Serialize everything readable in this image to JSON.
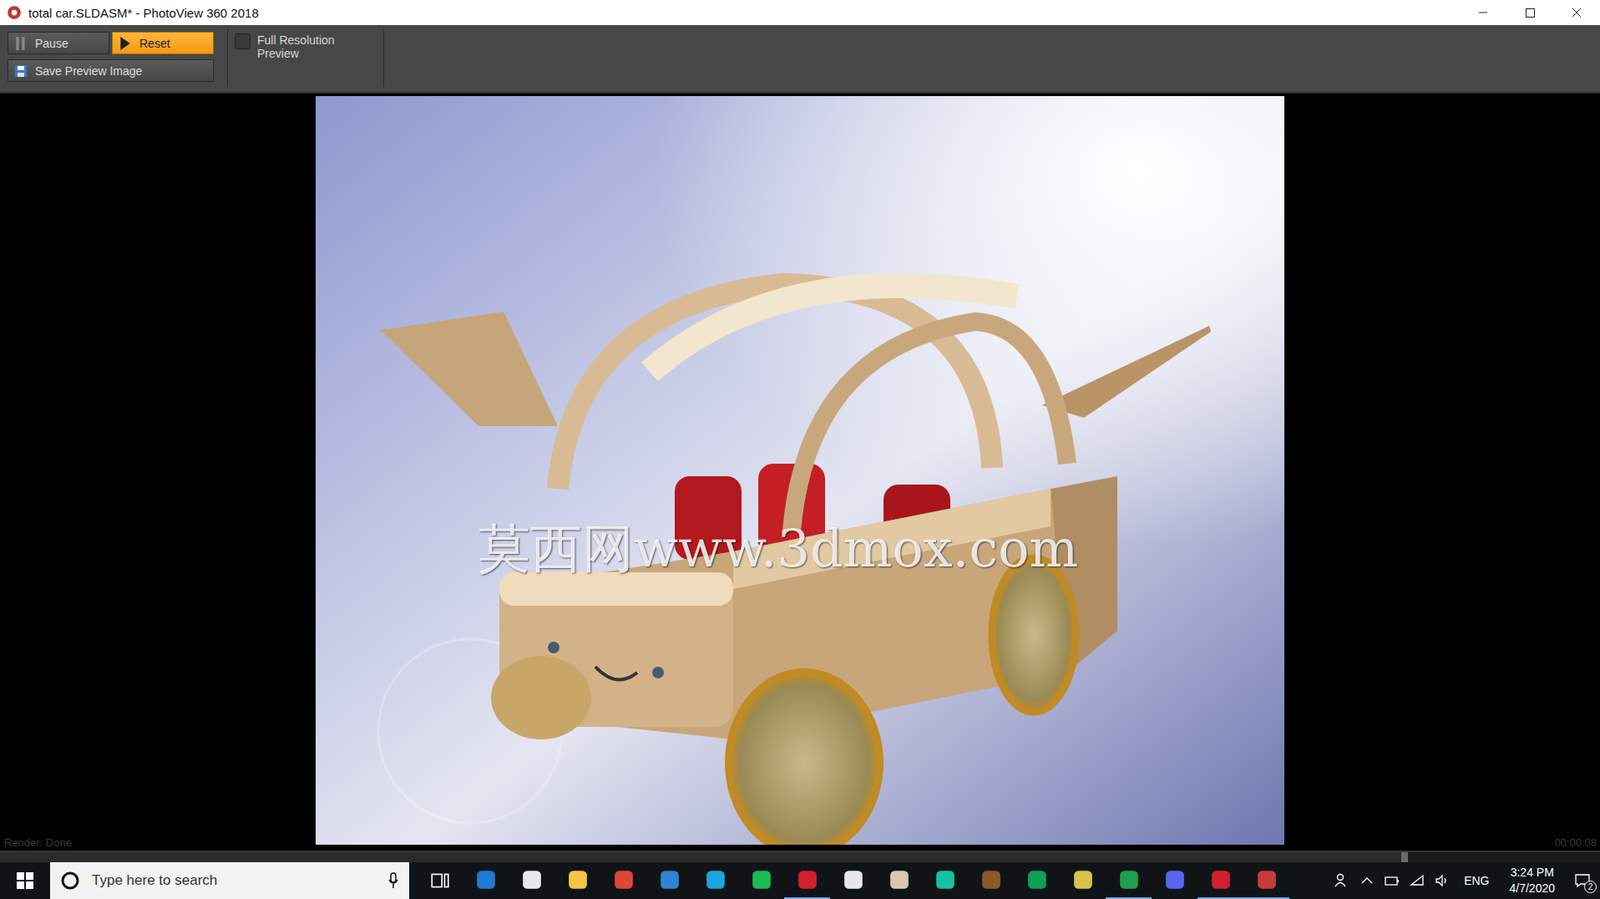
{
  "window": {
    "title": "total car.SLDASM* - PhotoView 360 2018"
  },
  "toolbar": {
    "buttons": [
      {
        "label": "Pause",
        "kind": "pause",
        "selected": false
      },
      {
        "label": "Reset",
        "kind": "play",
        "selected": true
      }
    ],
    "checkbox": {
      "label": "Full Resolution Preview",
      "checked": false
    },
    "save": {
      "label": "Save Preview Image"
    }
  },
  "render": {
    "watermark": "莫西网www.3dmox.com",
    "status": "Render: Done",
    "elapsed": "00:00:08",
    "level": 0.88
  },
  "taskbar": {
    "search": {
      "placeholder": "Type here to search"
    },
    "apps": [
      {
        "color": "#e6e6e6",
        "running": false
      },
      {
        "color": "#1f7ad4",
        "running": false
      },
      {
        "color": "#e8e8e8",
        "running": false
      },
      {
        "color": "#f4c542",
        "running": false
      },
      {
        "color": "#e0453a",
        "running": false
      },
      {
        "color": "#2f83d6",
        "running": false
      },
      {
        "color": "#1fa3e2",
        "running": false
      },
      {
        "color": "#1db954",
        "running": false
      },
      {
        "color": "#d0202e",
        "running": true
      },
      {
        "color": "#e7e7e7",
        "running": false
      },
      {
        "color": "#d9c8b0",
        "running": false
      },
      {
        "color": "#15c39a",
        "running": false
      },
      {
        "color": "#8b5a2b",
        "running": false
      },
      {
        "color": "#0f9d58",
        "running": false
      },
      {
        "color": "#d7c34a",
        "running": false
      },
      {
        "color": "#1f9e55",
        "running": true
      },
      {
        "color": "#5865f2",
        "running": false
      },
      {
        "color": "#d0202e",
        "running": true
      },
      {
        "color": "#c73a3a",
        "running": true
      }
    ],
    "language": "ENG",
    "time": "3:24 PM",
    "date": "4/7/2020",
    "notifications": "2"
  }
}
